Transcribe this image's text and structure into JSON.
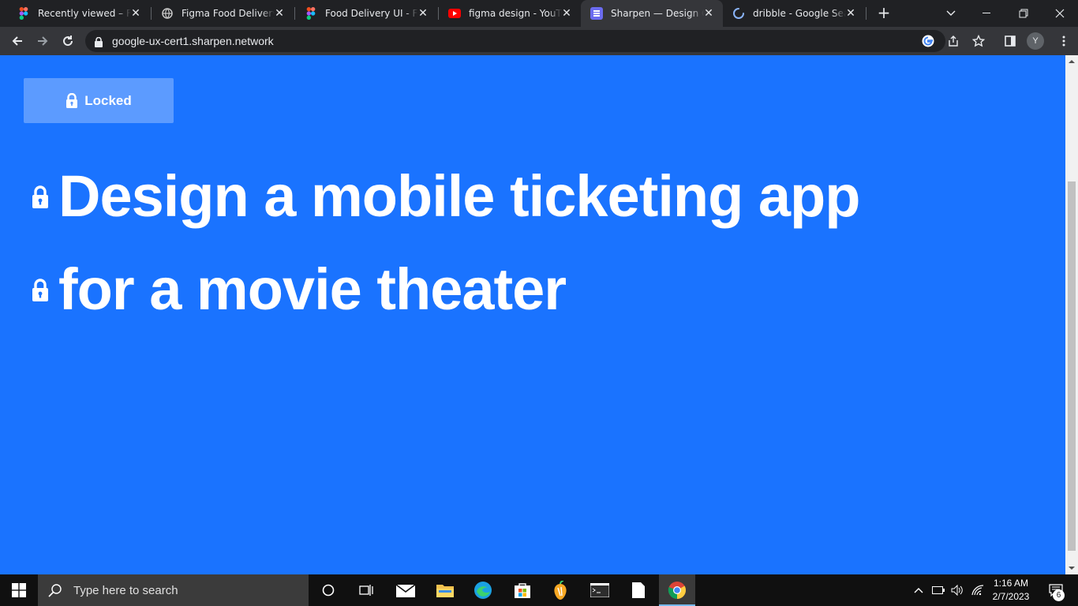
{
  "browser": {
    "tabs": [
      {
        "title": "Recently viewed – Figma",
        "icon": "figma-icon"
      },
      {
        "title": "Figma Food Delivery App",
        "icon": "globe-icon"
      },
      {
        "title": "Food Delivery UI - Free",
        "icon": "figma-icon"
      },
      {
        "title": "figma design - YouTube",
        "icon": "youtube-icon"
      },
      {
        "title": "Sharpen — Design Challenge",
        "icon": "sharpen-icon",
        "active": true
      },
      {
        "title": "dribble - Google Search",
        "icon": "loading-icon"
      }
    ],
    "url": "google-ux-cert1.sharpen.network",
    "profile_initial": "Y"
  },
  "page": {
    "locked_label": "Locked",
    "headline_lines": [
      "Design a mobile ticketing app",
      "for a movie theater"
    ],
    "background_color": "#1a73ff",
    "button_color": "#5c9bff"
  },
  "taskbar": {
    "search_placeholder": "Type here to search",
    "time": "1:16 AM",
    "date": "2/7/2023",
    "notification_count": "6"
  }
}
